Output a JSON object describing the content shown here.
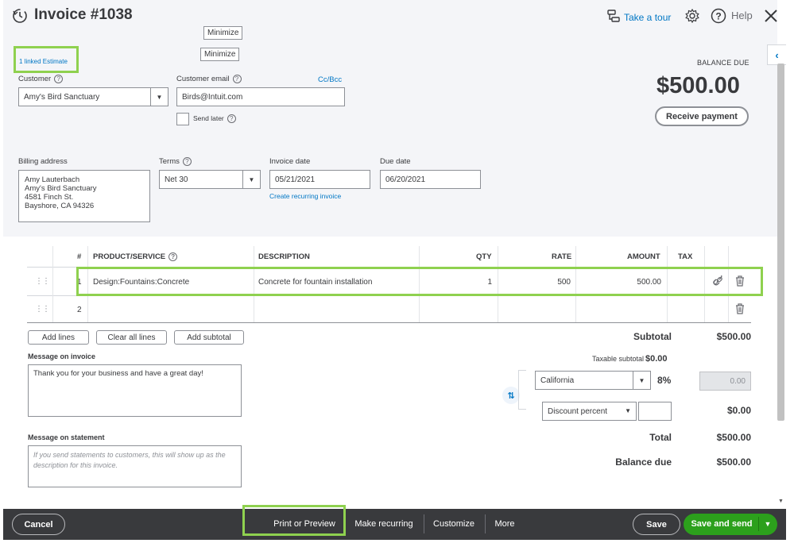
{
  "header": {
    "title": "Invoice #1038",
    "minimize_1": "Minimize",
    "minimize_2": "Minimize",
    "linked_estimate": "1 linked Estimate",
    "take_tour": "Take a tour",
    "help": "Help"
  },
  "customer": {
    "label": "Customer",
    "value": "Amy's Bird Sanctuary"
  },
  "email": {
    "label": "Customer email",
    "value": "Birds@Intuit.com",
    "cc_bcc": "Cc/Bcc",
    "send_later": "Send later"
  },
  "balance": {
    "label": "BALANCE DUE",
    "amount": "$500.00",
    "receive_payment": "Receive payment"
  },
  "billing": {
    "label": "Billing address",
    "line1": "Amy Lauterbach",
    "line2": "Amy's Bird Sanctuary",
    "line3": "4581 Finch St.",
    "line4": "Bayshore, CA  94326"
  },
  "terms": {
    "label": "Terms",
    "value": "Net 30"
  },
  "invoice_date": {
    "label": "Invoice date",
    "value": "05/21/2021",
    "recurring_link": "Create recurring invoice"
  },
  "due_date": {
    "label": "Due date",
    "value": "06/20/2021"
  },
  "table": {
    "headers": {
      "num": "#",
      "product": "PRODUCT/SERVICE",
      "description": "DESCRIPTION",
      "qty": "QTY",
      "rate": "RATE",
      "amount": "AMOUNT",
      "tax": "TAX"
    },
    "rows": [
      {
        "num": "1",
        "product": "Design:Fountains:Concrete",
        "description": "Concrete for fountain installation",
        "qty": "1",
        "rate": "500",
        "amount": "500.00"
      },
      {
        "num": "2",
        "product": "",
        "description": "",
        "qty": "",
        "rate": "",
        "amount": ""
      }
    ]
  },
  "table_actions": {
    "add_lines": "Add lines",
    "clear_all_lines": "Clear all lines",
    "add_subtotal": "Add subtotal"
  },
  "message_invoice": {
    "label": "Message on invoice",
    "value": "Thank you for your business and have a great day!"
  },
  "message_statement": {
    "label": "Message on statement",
    "placeholder": "If you send statements to customers, this will show up as the description for this invoice."
  },
  "totals": {
    "subtotal_label": "Subtotal",
    "subtotal_value": "$500.00",
    "taxable_subtotal_label": "Taxable subtotal",
    "taxable_subtotal_value": "$0.00",
    "tax_region": "California",
    "tax_rate": "8%",
    "tax_amount": "0.00",
    "discount_type": "Discount percent",
    "discount_value": "$0.00",
    "total_label": "Total",
    "total_value": "$500.00",
    "balance_due_label": "Balance due",
    "balance_due_value": "$500.00"
  },
  "footer": {
    "cancel": "Cancel",
    "print_preview": "Print or Preview",
    "make_recurring": "Make recurring",
    "customize": "Customize",
    "more": "More",
    "save": "Save",
    "save_and_send": "Save and send"
  },
  "colors": {
    "accent_green": "#2ca01c",
    "highlight_green": "#8fd14f",
    "link_blue": "#0077c5",
    "footer_bg": "#393a3d"
  }
}
